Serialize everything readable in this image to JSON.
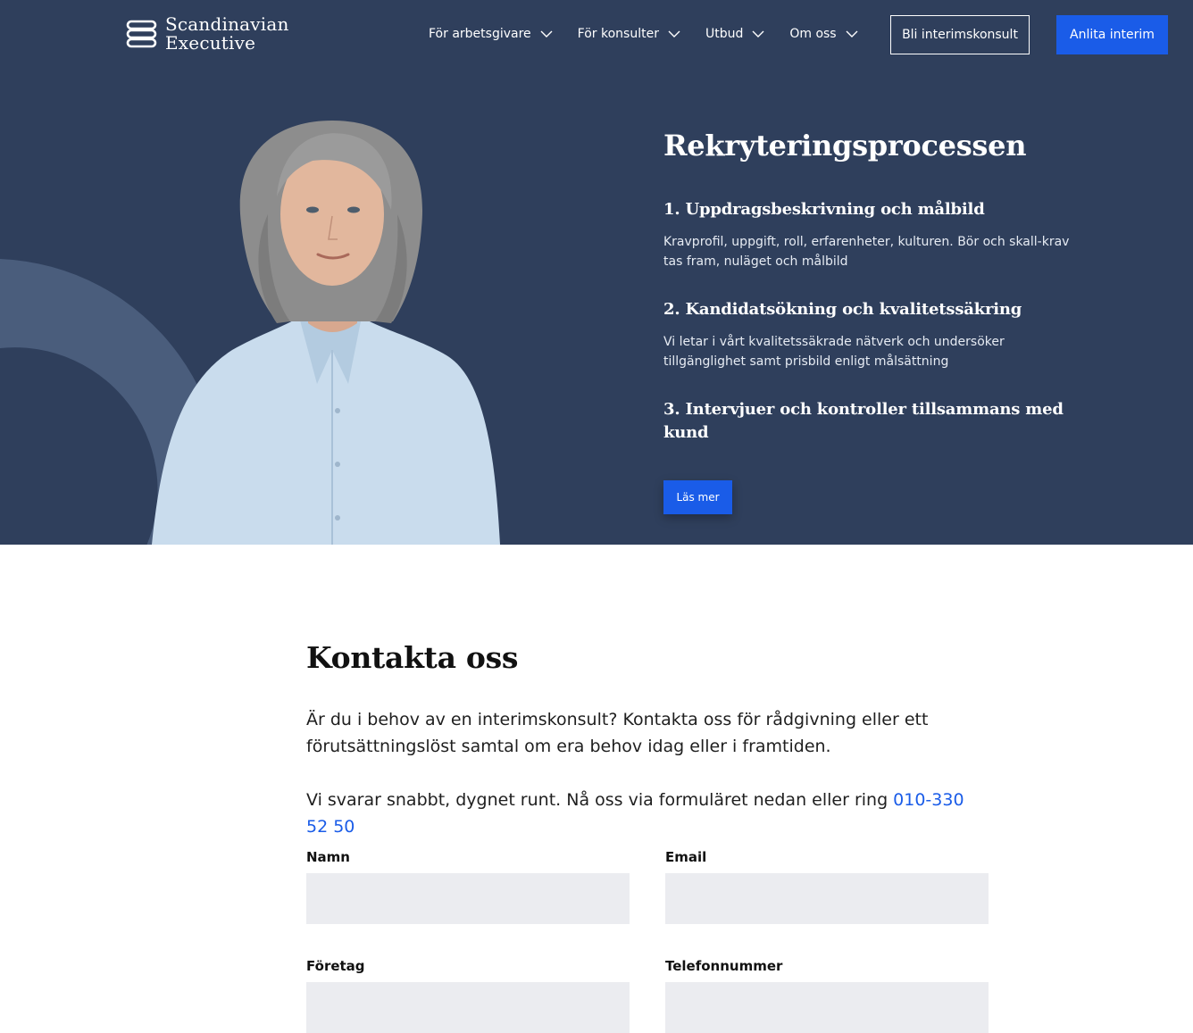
{
  "header": {
    "logo_line1": "Scandinavian",
    "logo_line2": "Executive",
    "nav": [
      {
        "label": "För arbetsgivare"
      },
      {
        "label": "För konsulter"
      },
      {
        "label": "Utbud"
      },
      {
        "label": "Om oss"
      }
    ],
    "btn_outline": "Bli interimskonsult",
    "btn_primary": "Anlita interim"
  },
  "hero": {
    "title": "Rekryteringsprocessen",
    "steps": [
      {
        "title": "1. Uppdragsbeskrivning och målbild",
        "desc": "Kravprofil, uppgift, roll, erfarenheter, kulturen. Bör och skall-krav tas fram, nuläget och målbild"
      },
      {
        "title": "2. Kandidatsökning och kvalitetssäkring",
        "desc": "Vi letar i vårt kvalitetssäkrade nätverk och undersöker tillgänglighet samt prisbild enligt målsättning"
      },
      {
        "title": "3. Intervjuer och kontroller tillsammans med kund"
      }
    ],
    "cta": "Läs mer"
  },
  "contact": {
    "title": "Kontakta oss",
    "intro": "Är du i behov av en interimskonsult? Kontakta oss för rådgivning eller ett förutsättningslöst samtal om era behov idag eller i framtiden.",
    "reach_prefix": "Vi svarar snabbt, dygnet runt. Nå oss via formuläret nedan eller ring ",
    "phone": "010-330 52 50",
    "fields": {
      "name": "Namn",
      "email": "Email",
      "company": "Företag",
      "phone": "Telefonnummer"
    }
  },
  "colors": {
    "hero_bg": "#2f3f5c",
    "accent": "#1a5ce8",
    "input_bg": "#ebecf0"
  }
}
